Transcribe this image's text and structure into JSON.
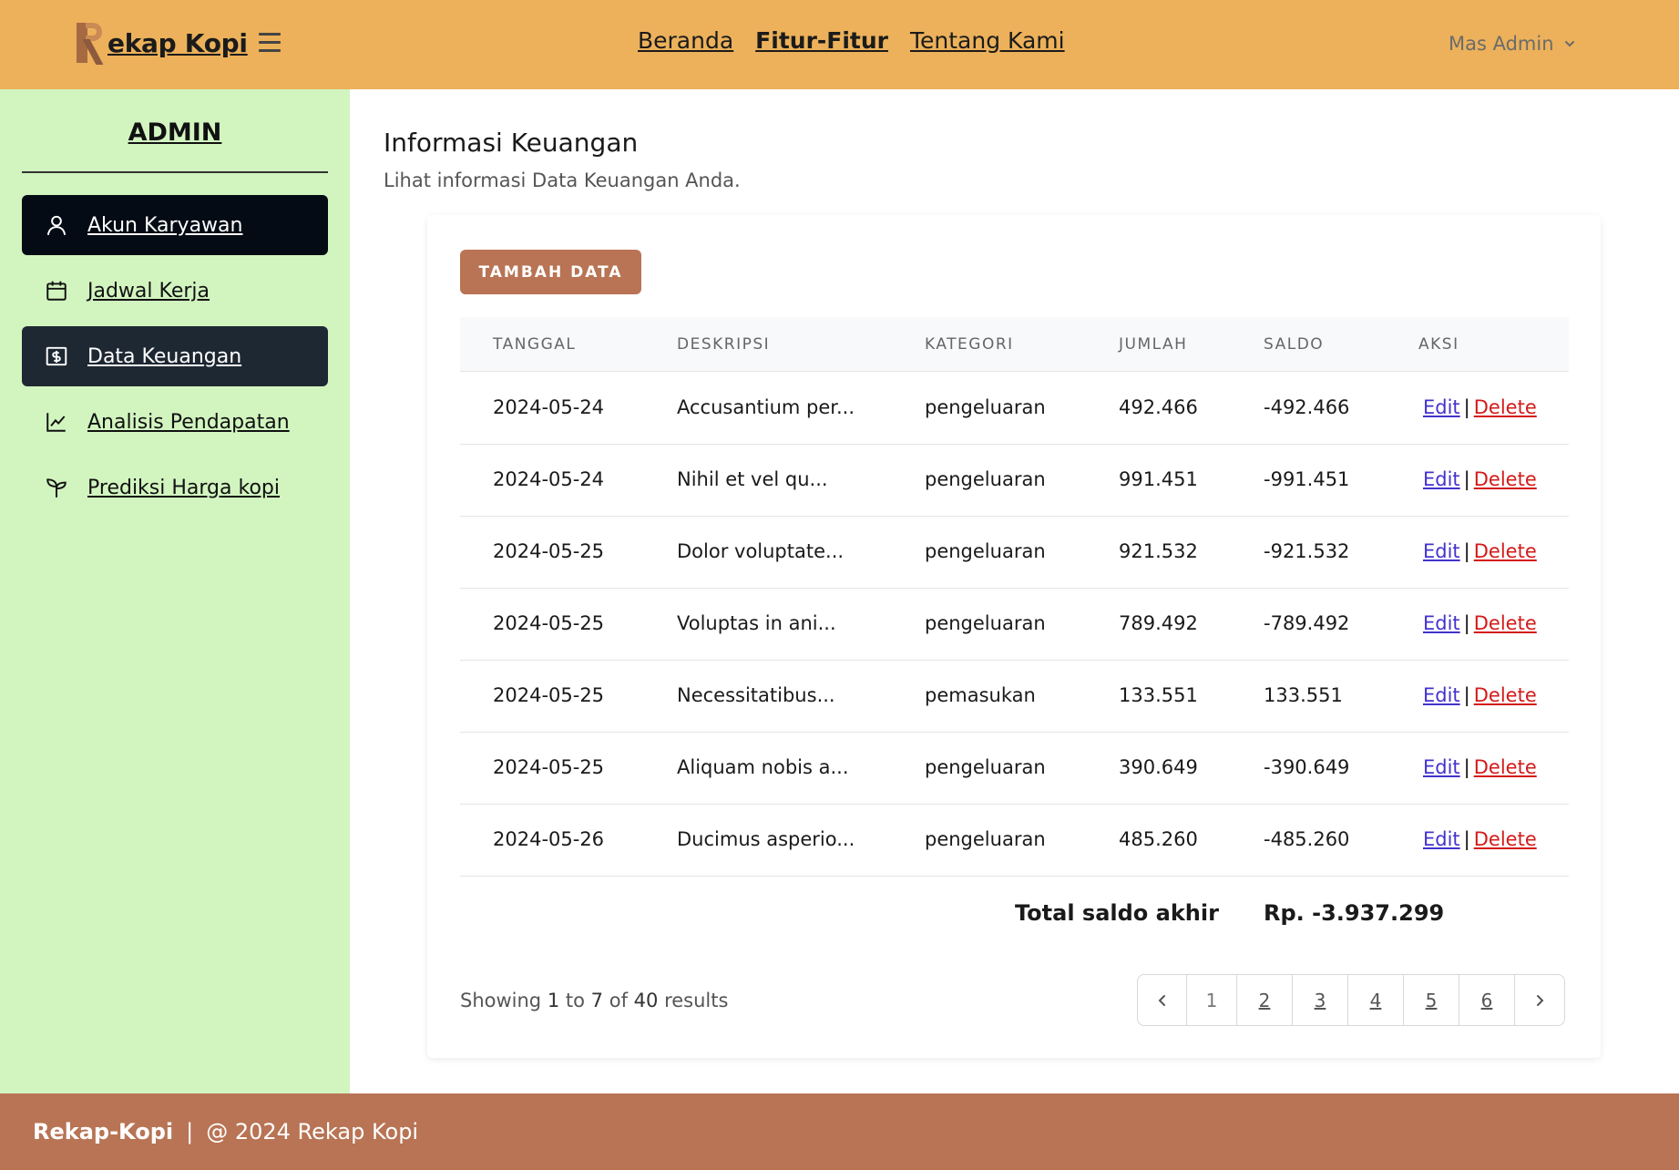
{
  "header": {
    "brand_letter": "R",
    "brand": "ekap Kopi",
    "nav": [
      "Beranda",
      "Fitur-Fitur",
      "Tentang Kami"
    ],
    "user": "Mas Admin"
  },
  "sidebar": {
    "title": "ADMIN",
    "items": [
      {
        "label": "Akun Karyawan",
        "icon": "user-icon"
      },
      {
        "label": "Jadwal Kerja",
        "icon": "calendar-icon"
      },
      {
        "label": "Data Keuangan",
        "icon": "money-icon"
      },
      {
        "label": "Analisis Pendapatan",
        "icon": "chart-line-icon"
      },
      {
        "label": "Prediksi Harga kopi",
        "icon": "sprout-icon"
      }
    ]
  },
  "main": {
    "title": "Informasi Keuangan",
    "subtitle": "Lihat informasi Data Keuangan Anda.",
    "add_button": "TAMBAH DATA"
  },
  "table": {
    "headers": [
      "TANGGAL",
      "DESKRIPSI",
      "KATEGORI",
      "JUMLAH",
      "SALDO",
      "AKSI"
    ],
    "rows": [
      [
        "2024-05-24",
        "Accusantium per...",
        "pengeluaran",
        "492.466",
        "-492.466"
      ],
      [
        "2024-05-24",
        "Nihil et vel qu...",
        "pengeluaran",
        "991.451",
        "-991.451"
      ],
      [
        "2024-05-25",
        "Dolor voluptate...",
        "pengeluaran",
        "921.532",
        "-921.532"
      ],
      [
        "2024-05-25",
        "Voluptas in ani...",
        "pengeluaran",
        "789.492",
        "-789.492"
      ],
      [
        "2024-05-25",
        "Necessitatibus...",
        "pemasukan",
        "133.551",
        "133.551"
      ],
      [
        "2024-05-25",
        "Aliquam nobis a...",
        "pengeluaran",
        "390.649",
        "-390.649"
      ],
      [
        "2024-05-26",
        "Ducimus asperio...",
        "pengeluaran",
        "485.260",
        "-485.260"
      ]
    ],
    "edit": "Edit",
    "separator": "|",
    "delete": "Delete",
    "total_label": "Total saldo akhir",
    "total_value": "Rp. -3.937.299"
  },
  "pagination": {
    "showing_prefix": "Showing",
    "from": "1",
    "to_word": "to",
    "to": "7",
    "of_word": "of",
    "total": "40",
    "suffix": "results",
    "pages": [
      "1",
      "2",
      "3",
      "4",
      "5",
      "6"
    ],
    "current": "1"
  },
  "footer": {
    "brand": "Rekap-Kopi",
    "separator": "|",
    "copyright": "@ 2024 Rekap Kopi"
  },
  "colors": {
    "topbar": "#ecb15a",
    "sidebar": "#d2f5c0",
    "accent": "#b87454",
    "active_item": "#040b14",
    "selected_item": "#1e2833"
  }
}
